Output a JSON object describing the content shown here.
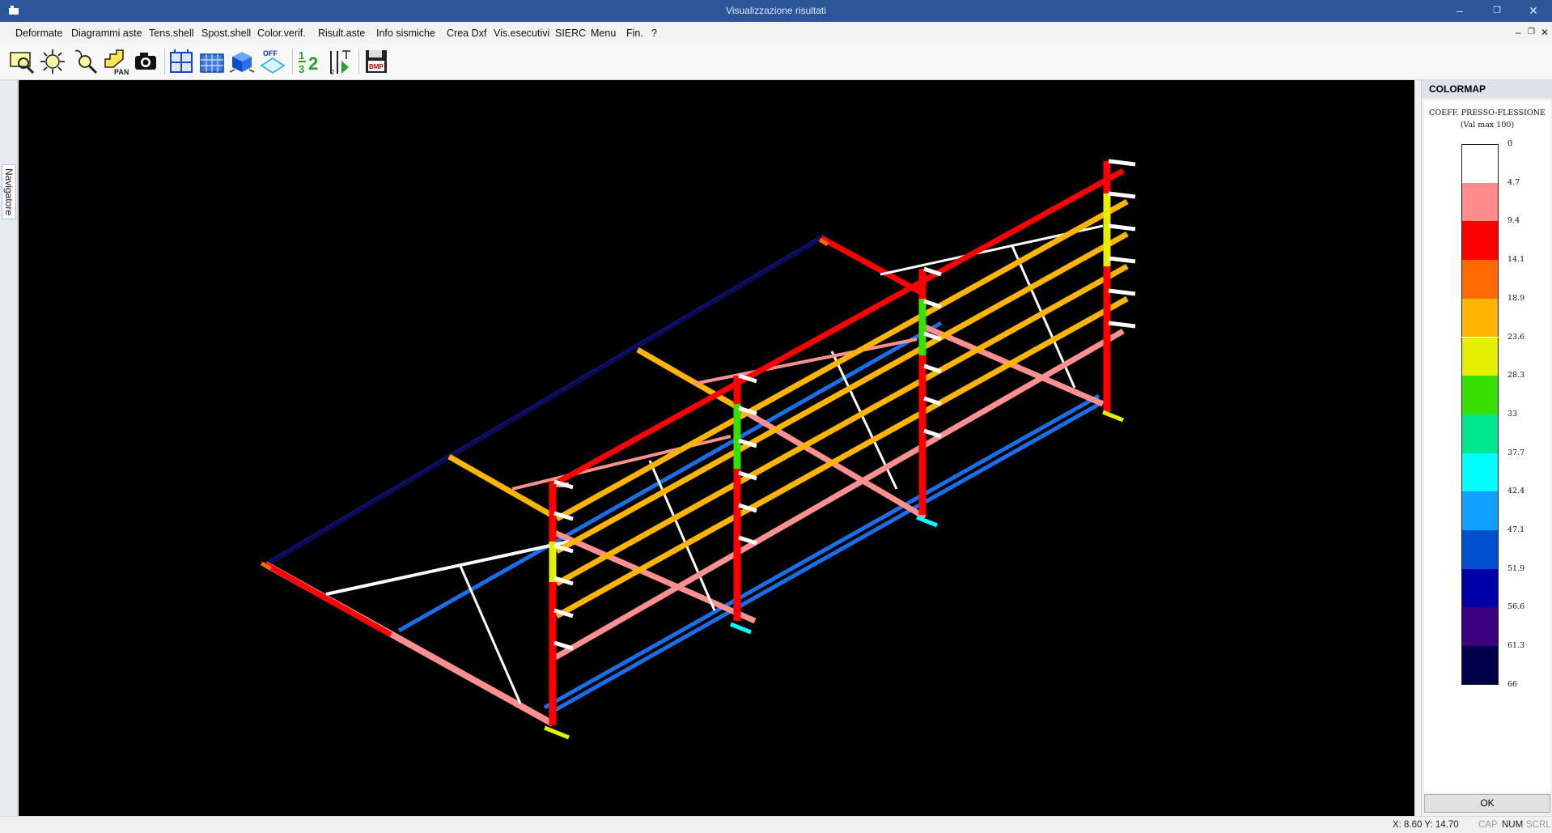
{
  "window": {
    "title": "Visualizzazione risultati",
    "minimize_glyph": "–",
    "restore_glyph": "❐",
    "close_glyph": "✕"
  },
  "menu": {
    "items": [
      "Deformate",
      "Diagrammi aste",
      "Tens.shell",
      "Spost.shell",
      "Color.verif.",
      "Risult.aste",
      "Info sismiche",
      "Crea Dxf",
      "Vis.esecutivi",
      "SIERC",
      "Menu",
      "Fin.",
      "?"
    ],
    "mdi_minimize": "–",
    "mdi_restore": "❐",
    "mdi_close": "✕"
  },
  "toolbar": {
    "buttons": [
      "zoom-window-icon",
      "zoom-extents-icon",
      "zoom-realtime-icon",
      "pan-icon",
      "camera-icon",
      "frame-view-icon",
      "building-view-icon",
      "3d-cube-icon",
      "off-plane-icon",
      "numbering-icon",
      "axes-icon",
      "bmp-save-icon"
    ],
    "pan_label": "PAN",
    "off_label": "OFF",
    "numbering_label_1": "1",
    "numbering_label_2": "3",
    "numbering_label_3": "2",
    "axes_label": "2",
    "bmp_label": "BMP"
  },
  "navigator": {
    "label": "Navigatore"
  },
  "colormap": {
    "header": "COLORMAP",
    "title_line1": "COEFF. PRESSO-FLESSIONE",
    "title_line2": "(Val max 100)",
    "ticks": [
      "0",
      "4.7",
      "9.4",
      "14.1",
      "18.9",
      "23.6",
      "28.3",
      "33",
      "37.7",
      "42.4",
      "47.1",
      "51.9",
      "56.6",
      "61.3",
      "66"
    ],
    "colors": [
      "#ffffff",
      "#ff8a8a",
      "#ff0000",
      "#ff6a00",
      "#ffb400",
      "#e4f000",
      "#38e000",
      "#00e890",
      "#00ffff",
      "#10a0ff",
      "#0050d0",
      "#0000a8",
      "#3a0080",
      "#00004a"
    ]
  },
  "ok_button": "OK",
  "status": {
    "coords": "X:  8.60  Y: 14.70",
    "cap": "CAP",
    "num": "NUM",
    "scrl": "SCRL"
  }
}
